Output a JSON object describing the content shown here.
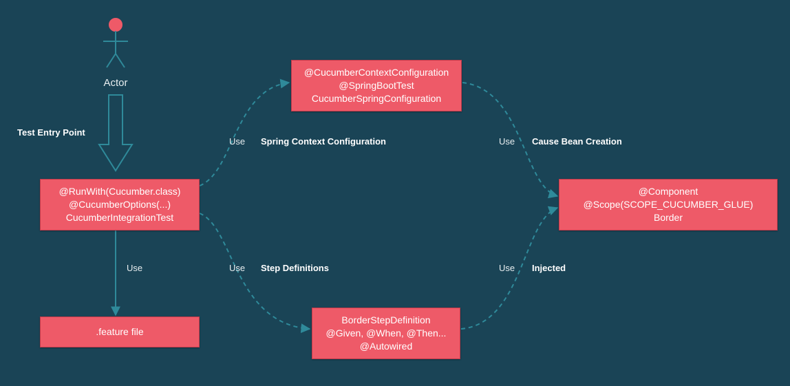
{
  "actor": {
    "label": "Actor"
  },
  "labels": {
    "test_entry_point": "Test Entry Point",
    "spring_ctx_cfg": "Spring Context Configuration",
    "step_defs": "Step Definitions",
    "cause_bean": "Cause Bean Creation",
    "injected": "Injected",
    "use1": "Use",
    "use2": "Use",
    "use3": "Use",
    "use4": "Use",
    "use5": "Use"
  },
  "nodes": {
    "entry": {
      "line1": "@RunWith(Cucumber.class)",
      "line2": "@CucumberOptions(...)",
      "line3": "CucumberIntegrationTest"
    },
    "feature": {
      "line1": ".feature file"
    },
    "spring_cfg": {
      "line1": "@CucumberContextConfiguration",
      "line2": "@SpringBootTest",
      "line3": "CucumberSpringConfiguration"
    },
    "step_def": {
      "line1": "BorderStepDefinition",
      "line2": "@Given, @When, @Then...",
      "line3": "@Autowired"
    },
    "component": {
      "line1": "@Component",
      "line2": "@Scope(SCOPE_CUCUMBER_GLUE)",
      "line3": "Border"
    }
  },
  "colors": {
    "bg": "#1a4456",
    "node": "#ee5a68",
    "stroke": "#2f8a9a",
    "actor_head": "#ee5a68"
  }
}
